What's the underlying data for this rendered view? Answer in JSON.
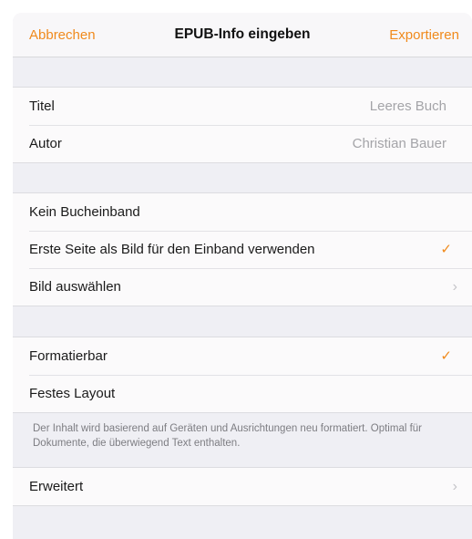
{
  "nav": {
    "cancel_label": "Abbrechen",
    "title": "EPUB-Info eingeben",
    "export_label": "Exportieren"
  },
  "metadata": {
    "title_label": "Titel",
    "title_value": "Leeres Buch",
    "author_label": "Autor",
    "author_value": "Christian Bauer"
  },
  "cover": {
    "no_cover_label": "Kein Bucheinband",
    "first_page_label": "Erste Seite als Bild für den Einband verwenden",
    "choose_image_label": "Bild auswählen",
    "selected": "first_page"
  },
  "layout": {
    "reflowable_label": "Formatierbar",
    "fixed_label": "Festes Layout",
    "selected": "reflowable",
    "note": "Der Inhalt wird basierend auf Geräten und Ausrichtungen neu formatiert. Optimal für Dokumente, die überwiegend Text enthalten."
  },
  "advanced": {
    "label": "Erweitert"
  },
  "icons": {
    "check": "checkmark-icon",
    "chevron": "chevron-right-icon"
  },
  "colors": {
    "accent": "#f08a1c",
    "background": "#efeff4"
  }
}
